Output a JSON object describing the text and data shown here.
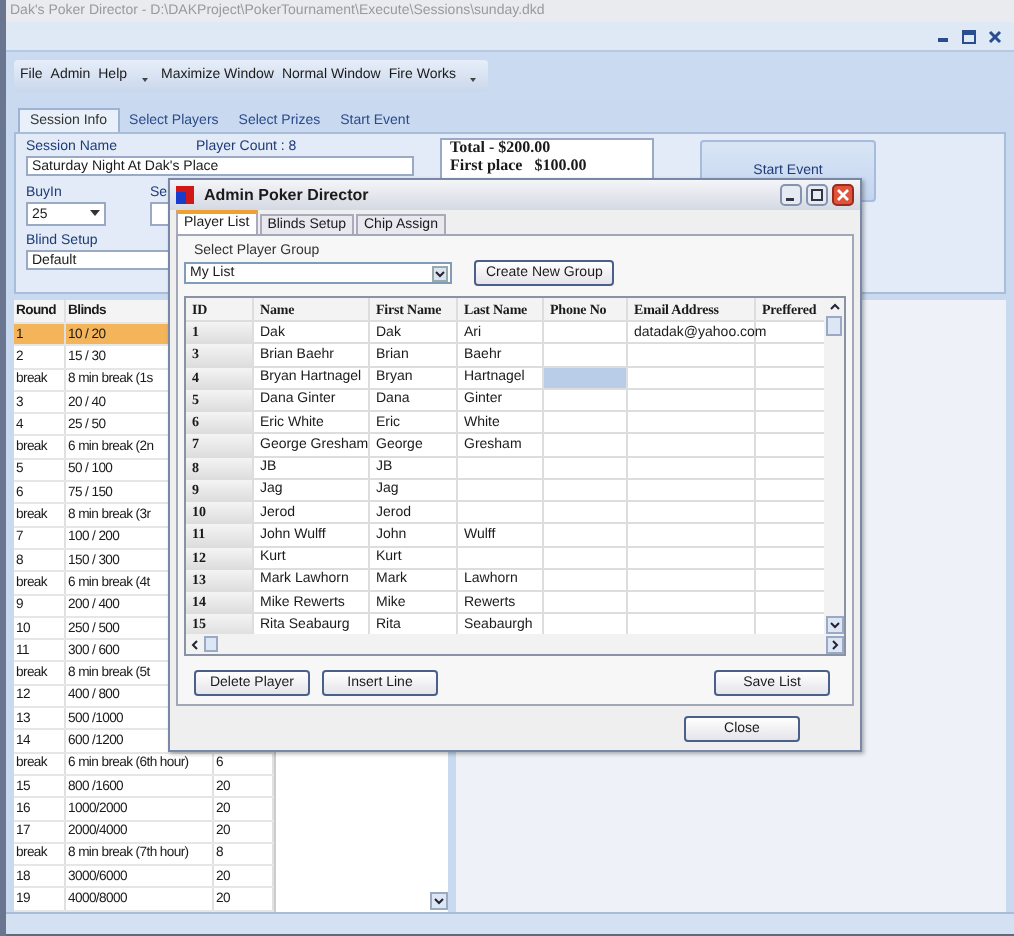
{
  "window": {
    "title": "Dak's Poker Director - D:\\DAKProject\\PokerTournament\\Execute\\Sessions\\sunday.dkd"
  },
  "menu": [
    "File",
    "Admin",
    "Help"
  ],
  "toolbar": [
    "Maximize Window",
    "Normal Window",
    "Fire Works"
  ],
  "tabs": [
    {
      "label": "Session Info",
      "selected": true
    },
    {
      "label": "Select Players",
      "selected": false
    },
    {
      "label": "Select Prizes",
      "selected": false
    },
    {
      "label": "Start Event",
      "selected": false
    }
  ],
  "session": {
    "name_label": "Session Name",
    "name_value": "Saturday Night At Dak's Place",
    "player_count": "Player Count : 8",
    "buyin_label": "BuyIn",
    "buyin_value": "25",
    "cut_label": "Se",
    "blind_setup_label": "Blind Setup",
    "blind_setup_value": "Default",
    "totals": [
      "Total - $200.00",
      "First place   $100.00"
    ],
    "start_button": "Start Event"
  },
  "blinds_table": {
    "columns": [
      "Round",
      "Blinds"
    ],
    "rows": [
      {
        "round": "1",
        "blinds": "10 / 20",
        "selected": true
      },
      {
        "round": "2",
        "blinds": "15 / 30",
        "selected": false
      },
      {
        "round": "break",
        "blinds": "8 min break (1s",
        "selected": false
      },
      {
        "round": "3",
        "blinds": "20 / 40",
        "selected": false
      },
      {
        "round": "4",
        "blinds": "25 / 50",
        "selected": false
      },
      {
        "round": "break",
        "blinds": "6 min break (2n",
        "selected": false
      },
      {
        "round": "5",
        "blinds": "50 / 100",
        "selected": false
      },
      {
        "round": "6",
        "blinds": "75 / 150",
        "selected": false
      },
      {
        "round": "break",
        "blinds": "8 min break (3r",
        "selected": false
      },
      {
        "round": "7",
        "blinds": "100 / 200",
        "selected": false
      },
      {
        "round": "8",
        "blinds": "150 / 300",
        "selected": false
      },
      {
        "round": "break",
        "blinds": "6 min break (4t",
        "selected": false
      },
      {
        "round": "9",
        "blinds": "200 / 400",
        "selected": false
      },
      {
        "round": "10",
        "blinds": "250 / 500",
        "selected": false
      },
      {
        "round": "11",
        "blinds": "300 / 600",
        "selected": false
      },
      {
        "round": "break",
        "blinds": "8 min break (5t",
        "selected": false
      },
      {
        "round": "12",
        "blinds": "400 / 800",
        "selected": false
      },
      {
        "round": "13",
        "blinds": "500 /1000",
        "selected": false
      },
      {
        "round": "14",
        "blinds": "600 /1200",
        "selected": false
      },
      {
        "round": "break",
        "blinds": "6 min break (6th hour)",
        "column_3": "6",
        "selected": false
      },
      {
        "round": "15",
        "blinds": "800 /1600",
        "column_3": "20",
        "selected": false
      },
      {
        "round": "16",
        "blinds": "1000/2000",
        "column_3": "20",
        "selected": false
      },
      {
        "round": "17",
        "blinds": "2000/4000",
        "column_3": "20",
        "selected": false
      },
      {
        "round": "break",
        "blinds": "8 min break (7th hour)",
        "column_3": "8",
        "selected": false
      },
      {
        "round": "18",
        "blinds": "3000/6000",
        "column_3": "20",
        "selected": false
      },
      {
        "round": "19",
        "blinds": "4000/8000",
        "column_3": "20",
        "selected": false
      }
    ]
  },
  "dialog": {
    "title": "Admin Poker Director",
    "tabs": [
      {
        "label": "Player List",
        "selected": true
      },
      {
        "label": "Blinds Setup",
        "selected": false
      },
      {
        "label": "Chip Assign",
        "selected": false
      }
    ],
    "group_label": "Select Player Group",
    "group_value": "My List",
    "create_button": "Create New Group",
    "columns": [
      "ID",
      "Name",
      "First Name",
      "Last Name",
      "Phone No",
      "Email Address",
      "Preffered"
    ],
    "rows": [
      {
        "id": "1",
        "name": "Dak",
        "first_name": "Dak",
        "last_name": "Ari",
        "email": "datadak@yahoo.com",
        "phone_selected": false
      },
      {
        "id": "3",
        "name": "Brian Baehr",
        "first_name": "Brian",
        "last_name": "Baehr",
        "phone_selected": false
      },
      {
        "id": "4",
        "name": "Bryan Hartnagel",
        "first_name": "Bryan",
        "last_name": "Hartnagel",
        "phone_selected": true
      },
      {
        "id": "5",
        "name": "Dana Ginter",
        "first_name": "Dana",
        "last_name": "Ginter",
        "phone_selected": false
      },
      {
        "id": "6",
        "name": "Eric White",
        "first_name": "Eric",
        "last_name": "White",
        "phone_selected": false
      },
      {
        "id": "7",
        "name": "George Gresham",
        "first_name": "George",
        "last_name": "Gresham",
        "phone_selected": false
      },
      {
        "id": "8",
        "name": "JB",
        "first_name": "JB",
        "phone_selected": false
      },
      {
        "id": "9",
        "name": "Jag",
        "first_name": "Jag",
        "phone_selected": false
      },
      {
        "id": "10",
        "name": "Jerod",
        "first_name": "Jerod",
        "phone_selected": false
      },
      {
        "id": "11",
        "name": "John Wulff",
        "first_name": "John",
        "last_name": "Wulff",
        "phone_selected": false
      },
      {
        "id": "12",
        "name": "Kurt",
        "first_name": "Kurt",
        "phone_selected": false
      },
      {
        "id": "13",
        "name": "Mark Lawhorn",
        "first_name": "Mark",
        "last_name": "Lawhorn",
        "phone_selected": false
      },
      {
        "id": "14",
        "name": "Mike Rewerts",
        "first_name": "Mike",
        "last_name": "Rewerts",
        "phone_selected": false
      },
      {
        "id": "15",
        "name": "Rita Seabaurg",
        "first_name": "Rita",
        "last_name": "Seabaurgh",
        "phone_selected": false
      }
    ],
    "buttons": [
      "Delete Player",
      "Insert Line",
      "Save List"
    ],
    "close_button": "Close"
  }
}
